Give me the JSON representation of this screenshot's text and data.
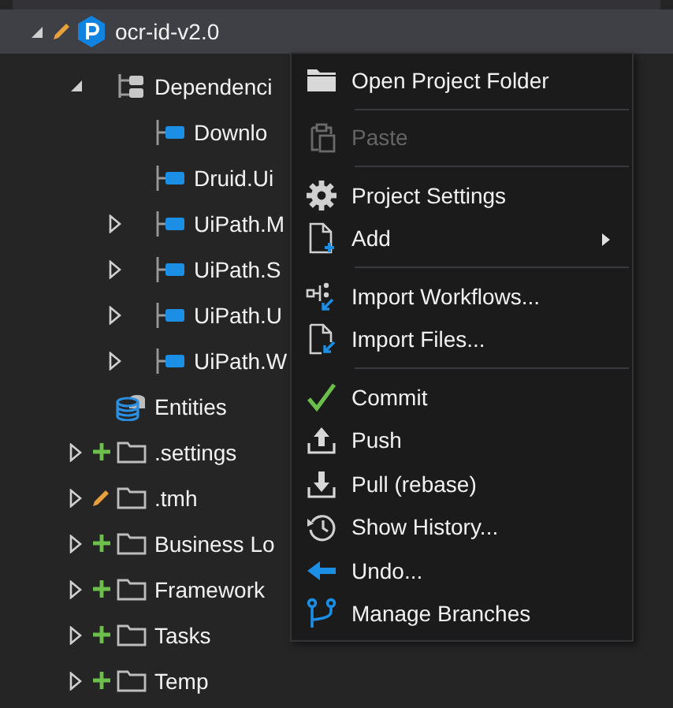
{
  "tree": [
    {
      "kind": "project",
      "label": "ocr-id-v2.0",
      "added": false,
      "modified": true,
      "expanded": true,
      "selected": true,
      "children": [
        {
          "kind": "dependencies",
          "label": "Dependenci",
          "expanded": true,
          "selected": false,
          "children": [
            {
              "kind": "package",
              "label": "Downlo",
              "selected": false
            },
            {
              "kind": "package",
              "label": "Druid.Ui",
              "selected": false
            },
            {
              "kind": "package",
              "label": "UiPath.M",
              "expanded": false,
              "selected": false
            },
            {
              "kind": "package",
              "label": "UiPath.S",
              "expanded": false,
              "selected": false
            },
            {
              "kind": "package",
              "label": "UiPath.U",
              "expanded": false,
              "selected": false
            },
            {
              "kind": "package",
              "label": "UiPath.W",
              "expanded": false,
              "selected": false
            }
          ]
        },
        {
          "kind": "entities",
          "label": "Entities",
          "selected": false
        },
        {
          "kind": "folder",
          "label": ".settings",
          "added": true,
          "modified": false,
          "expanded": false,
          "selected": false
        },
        {
          "kind": "folder",
          "label": ".tmh",
          "added": false,
          "modified": true,
          "expanded": false,
          "selected": false
        },
        {
          "kind": "folder",
          "label": "Business Lo",
          "added": true,
          "modified": false,
          "expanded": false,
          "selected": false
        },
        {
          "kind": "folder",
          "label": "Framework",
          "added": true,
          "modified": false,
          "expanded": false,
          "selected": false
        },
        {
          "kind": "folder",
          "label": "Tasks",
          "added": true,
          "modified": false,
          "expanded": false,
          "selected": false
        },
        {
          "kind": "folder",
          "label": "Temp",
          "added": true,
          "modified": false,
          "expanded": false,
          "selected": false
        }
      ]
    }
  ],
  "context_menu": [
    {
      "kind": "item",
      "label": "Open Project Folder",
      "disabled": false,
      "submenu": false
    },
    {
      "kind": "separator"
    },
    {
      "kind": "item",
      "label": "Paste",
      "disabled": true,
      "submenu": false
    },
    {
      "kind": "separator"
    },
    {
      "kind": "item",
      "label": "Project Settings",
      "disabled": false,
      "submenu": false
    },
    {
      "kind": "item",
      "label": "Add",
      "disabled": false,
      "submenu": true
    },
    {
      "kind": "separator"
    },
    {
      "kind": "item",
      "label": "Import Workflows...",
      "disabled": false,
      "submenu": false
    },
    {
      "kind": "item",
      "label": "Import Files...",
      "disabled": false,
      "submenu": false
    },
    {
      "kind": "separator"
    },
    {
      "kind": "item",
      "label": "Commit",
      "disabled": false,
      "submenu": false
    },
    {
      "kind": "item",
      "label": "Push",
      "disabled": false,
      "submenu": false
    },
    {
      "kind": "item",
      "label": "Pull (rebase)",
      "disabled": false,
      "submenu": false
    },
    {
      "kind": "item",
      "label": "Show History...",
      "disabled": false,
      "submenu": false
    },
    {
      "kind": "item",
      "label": "Undo...",
      "disabled": false,
      "submenu": false
    },
    {
      "kind": "item",
      "label": "Manage Branches",
      "disabled": false,
      "submenu": false
    }
  ]
}
